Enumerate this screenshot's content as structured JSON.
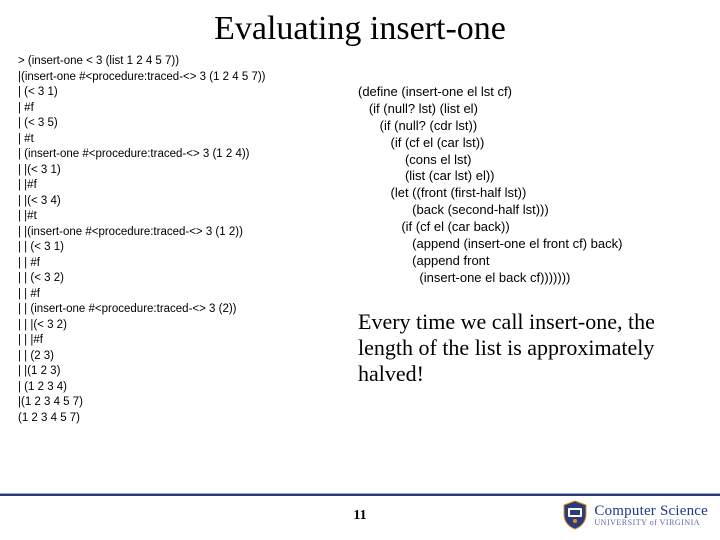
{
  "title": "Evaluating insert-one",
  "trace": "> (insert-one < 3 (list 1 2 4 5 7))\n|(insert-one #<procedure:traced-<> 3 (1 2 4 5 7))\n| (< 3 1)\n| #f\n| (< 3 5)\n| #t\n| (insert-one #<procedure:traced-<> 3 (1 2 4))\n| |(< 3 1)\n| |#f\n| |(< 3 4)\n| |#t\n| |(insert-one #<procedure:traced-<> 3 (1 2))\n| | (< 3 1)\n| | #f\n| | (< 3 2)\n| | #f\n| | (insert-one #<procedure:traced-<> 3 (2))\n| | |(< 3 2)\n| | |#f\n| | (2 3)\n| |(1 2 3)\n| (1 2 3 4)\n|(1 2 3 4 5 7)\n(1 2 3 4 5 7)",
  "code": "(define (insert-one el lst cf)\n   (if (null? lst) (list el)\n      (if (null? (cdr lst))\n         (if (cf el (car lst))\n             (cons el lst)\n             (list (car lst) el))\n         (let ((front (first-half lst))\n               (back (second-half lst)))\n            (if (cf el (car back))\n               (append (insert-one el front cf) back)\n               (append front\n                 (insert-one el back cf)))))))",
  "callout": "Every time we call insert-one, the length of the list is approximately halved!",
  "page": "11",
  "logo": {
    "main": "Computer Science",
    "sub": "UNIVERSITY of VIRGINIA"
  }
}
